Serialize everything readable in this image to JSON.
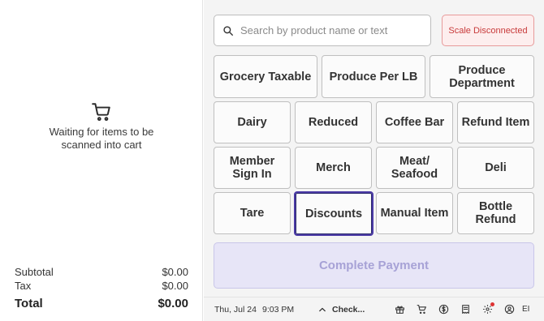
{
  "cart": {
    "empty_message": "Waiting for items to be scanned into cart"
  },
  "totals": {
    "subtotal_label": "Subtotal",
    "subtotal_value": "$0.00",
    "tax_label": "Tax",
    "tax_value": "$0.00",
    "total_label": "Total",
    "total_value": "$0.00"
  },
  "search": {
    "placeholder": "Search by product name or text"
  },
  "scale": {
    "status": "Scale Disconnected"
  },
  "buttons": {
    "grocery_taxable": "Grocery Taxable",
    "produce_per_lb": "Produce Per LB",
    "produce_department": "Produce Department",
    "dairy": "Dairy",
    "reduced": "Reduced",
    "coffee_bar": "Coffee Bar",
    "refund_item": "Refund Item",
    "member_sign_in": "Member Sign In",
    "merch": "Merch",
    "meat_seafood": "Meat/ Seafood",
    "deli": "Deli",
    "tare": "Tare",
    "discounts": "Discounts",
    "manual_item": "Manual Item",
    "bottle_refund": "Bottle Refund"
  },
  "complete_payment": "Complete Payment",
  "status_bar": {
    "date": "Thu, Jul 24",
    "time": "9:03 PM",
    "check_label": "Check...",
    "user_initials": "EI"
  },
  "colors": {
    "accent": "#4b3aa6",
    "complete_bg": "#e7e5f7",
    "complete_text": "#a7a2d6",
    "error": "#c83a3a"
  }
}
